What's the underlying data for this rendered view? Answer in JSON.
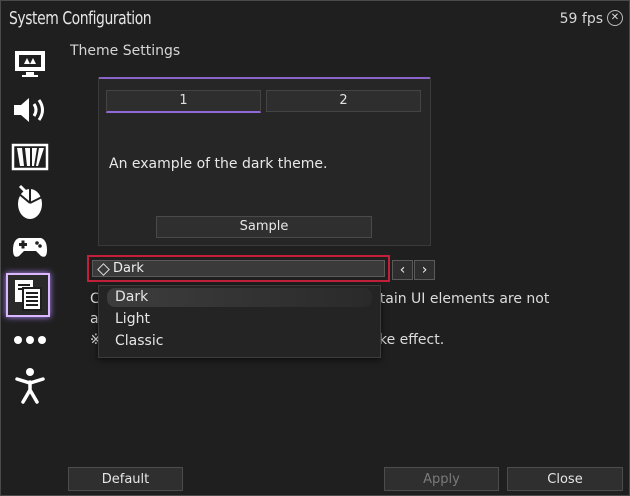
{
  "window": {
    "title": "System Configuration",
    "fps": "59 fps"
  },
  "sidebar": {
    "items": [
      {
        "icon": "display-icon",
        "active": false
      },
      {
        "icon": "speaker-icon",
        "active": false
      },
      {
        "icon": "filter-icon",
        "active": false
      },
      {
        "icon": "mouse-icon",
        "active": false
      },
      {
        "icon": "gamepad-icon",
        "active": false
      },
      {
        "icon": "document-icon",
        "active": true
      },
      {
        "icon": "more-icon",
        "active": false
      },
      {
        "icon": "accessibility-icon",
        "active": false
      }
    ]
  },
  "main": {
    "section_title": "Theme Settings",
    "preview": {
      "tabs": [
        {
          "label": "1"
        },
        {
          "label": "2"
        }
      ],
      "text": "An example of the dark theme.",
      "sample_label": "Sample"
    },
    "theme_select": {
      "value": "Dark",
      "options": [
        "Dark",
        "Light",
        "Classic"
      ]
    },
    "description_fragments": [
      "C",
      "rtain UI elements are not",
      "a",
      "※",
      "ke effect."
    ]
  },
  "footer": {
    "default_label": "Default",
    "apply_label": "Apply",
    "close_label": "Close"
  },
  "colors": {
    "accent_purple": "#8e6ad8",
    "highlight_red": "#c21f3a",
    "background": "#1f1f1f"
  }
}
